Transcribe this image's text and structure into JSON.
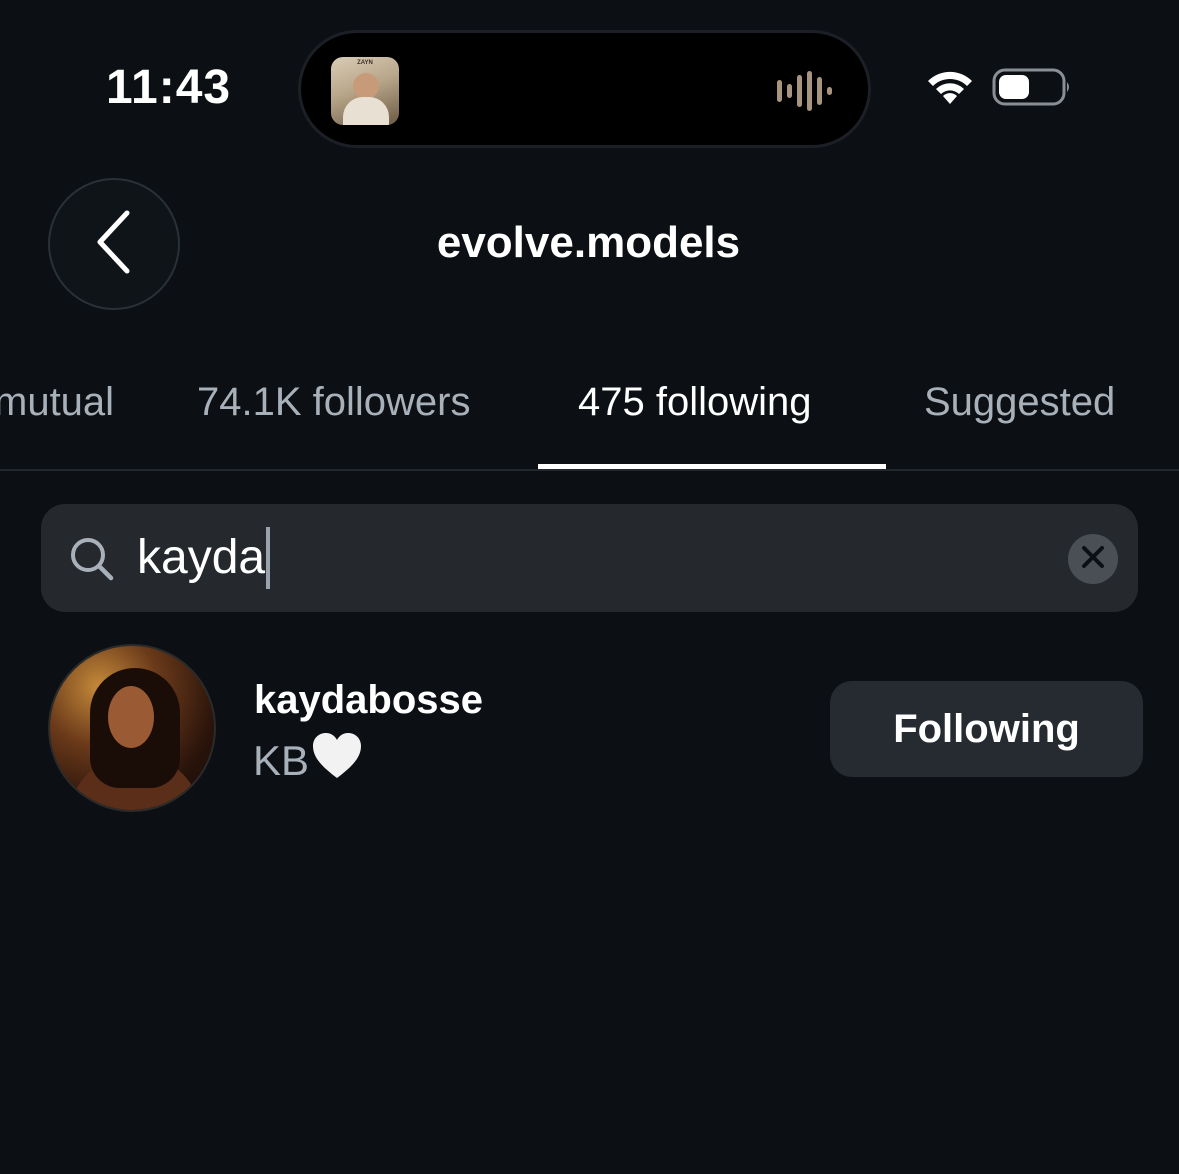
{
  "status_bar": {
    "time": "11:43",
    "now_playing_art": {
      "title": "ZAYN",
      "icon": "album-art"
    },
    "waveform_icon": "audio-waveform-icon",
    "wifi_icon": "wifi-icon",
    "battery_icon": "battery-icon"
  },
  "header": {
    "back_icon": "chevron-left-icon",
    "title": "evolve.models"
  },
  "tabs": [
    {
      "label": "mutual",
      "active": false
    },
    {
      "label": "74.1K followers",
      "active": false
    },
    {
      "label": "475 following",
      "active": true
    },
    {
      "label": "Suggested",
      "active": false
    }
  ],
  "search": {
    "value": "kayda",
    "search_icon": "search-icon",
    "clear_icon": "clear-icon"
  },
  "results": [
    {
      "username": "kaydabosse",
      "full_name": "KB",
      "full_name_emoji": "white-heart-icon",
      "button_label": "Following"
    }
  ],
  "colors": {
    "background": "#0c1014",
    "search_bg": "#25292e",
    "button_bg": "#262b31",
    "secondary_text": "#a8b0ba",
    "primary_text": "#ffffff"
  }
}
